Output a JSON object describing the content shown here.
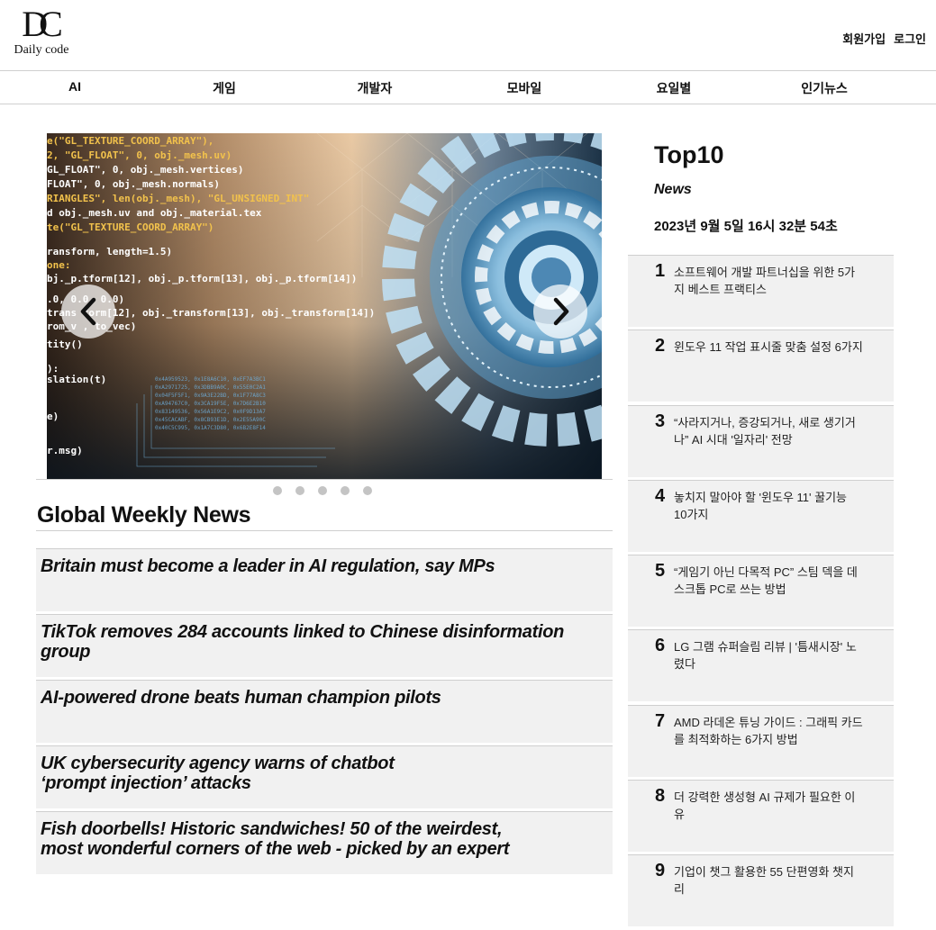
{
  "header": {
    "logo_mark": "DC",
    "logo_text": "Daily code",
    "signup_label": "회원가입",
    "login_label": "로그인"
  },
  "nav": {
    "items": [
      "AI",
      "게임",
      "개발자",
      "모바일",
      "요일별",
      "인기뉴스"
    ]
  },
  "carousel": {
    "slide_count": 5,
    "active_index": 0,
    "prev_icon": "chevron-left-icon",
    "next_icon": "chevron-right-icon"
  },
  "global_news": {
    "title": "Global Weekly News",
    "items": [
      "Britain must become a leader in AI regulation, say MPs",
      "TikTok removes 284 accounts linked to Chinese disinformation group",
      "AI-powered drone beats human champion pilots",
      "UK cybersecurity agency warns of chatbot\n‘prompt injection’ attacks",
      "Fish doorbells! Historic sandwiches! 50 of the weirdest,\nmost wonderful corners of the web - picked by an expert"
    ]
  },
  "top10": {
    "title": "Top10",
    "subtitle": "News",
    "date": "2023년 9월 5일 16시 32분 54초",
    "items": [
      {
        "rank": "1",
        "text": "소프트웨어 개발 파트너십을 위한 5가지 베스트 프랙티스"
      },
      {
        "rank": "2",
        "text": "윈도우 11 작업 표시줄 맞춤 설정 6가지"
      },
      {
        "rank": "3",
        "text": "“사라지거나, 증강되거나, 새로 생기거나” AI 시대 '일자리' 전망"
      },
      {
        "rank": "4",
        "text": "놓치지 말아야 할 '윈도우 11' 꿀기능 10가지"
      },
      {
        "rank": "5",
        "text": "“게임기 아닌 다목적 PC” 스팀 덱을 데스크톱 PC로 쓰는 방법"
      },
      {
        "rank": "6",
        "text": "LG 그램 슈퍼슬림 리뷰 | '틈새시장' 노렸다"
      },
      {
        "rank": "7",
        "text": "AMD 라데온 튜닝 가이드 : 그래픽 카드를 최적화하는 6가지 방법"
      },
      {
        "rank": "8",
        "text": "더 강력한 생성형 AI 규제가 필요한 이유"
      },
      {
        "rank": "9",
        "text": "기업이 챗그 활용한 55 단편영화 챗지리"
      }
    ]
  }
}
